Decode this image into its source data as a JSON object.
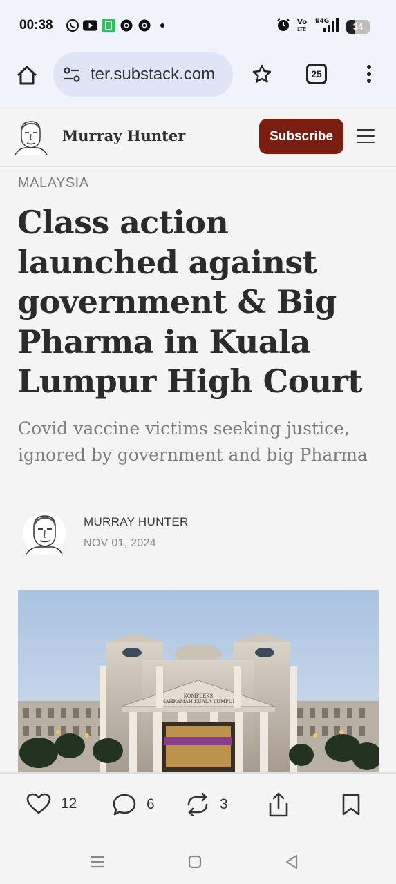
{
  "status_bar": {
    "time": "00:38",
    "battery": "34",
    "icons_left": [
      "whatsapp-icon",
      "youtube-icon",
      "app-icon",
      "chrome-icon",
      "chrome-icon",
      "dot-icon"
    ],
    "icons_right": [
      "alarm-icon",
      "volte-icon",
      "signal-4g-icon",
      "battery-icon"
    ]
  },
  "browser": {
    "url": "ter.substack.com",
    "tab_count": "25"
  },
  "site": {
    "name": "Murray Hunter",
    "subscribe_label": "Subscribe"
  },
  "article": {
    "category": "MALAYSIA",
    "title": "Class action launched against government & Big Pharma in Kuala Lumpur High Court",
    "subtitle": "Covid vaccine victims seeking justice, ignored by government and big Pharma",
    "author": "MURRAY HUNTER",
    "date": "NOV 01, 2024",
    "hero_sign": "KOMPLEKS MAHKAMAH KUALA LUMPUR"
  },
  "actions": {
    "likes": "12",
    "comments": "6",
    "restacks": "3"
  },
  "colors": {
    "subscribe_bg": "#7b1e12",
    "url_pill": "#dfe5f7",
    "chrome_bg": "#f1f3fa",
    "page_bg": "#f4f4f4"
  }
}
